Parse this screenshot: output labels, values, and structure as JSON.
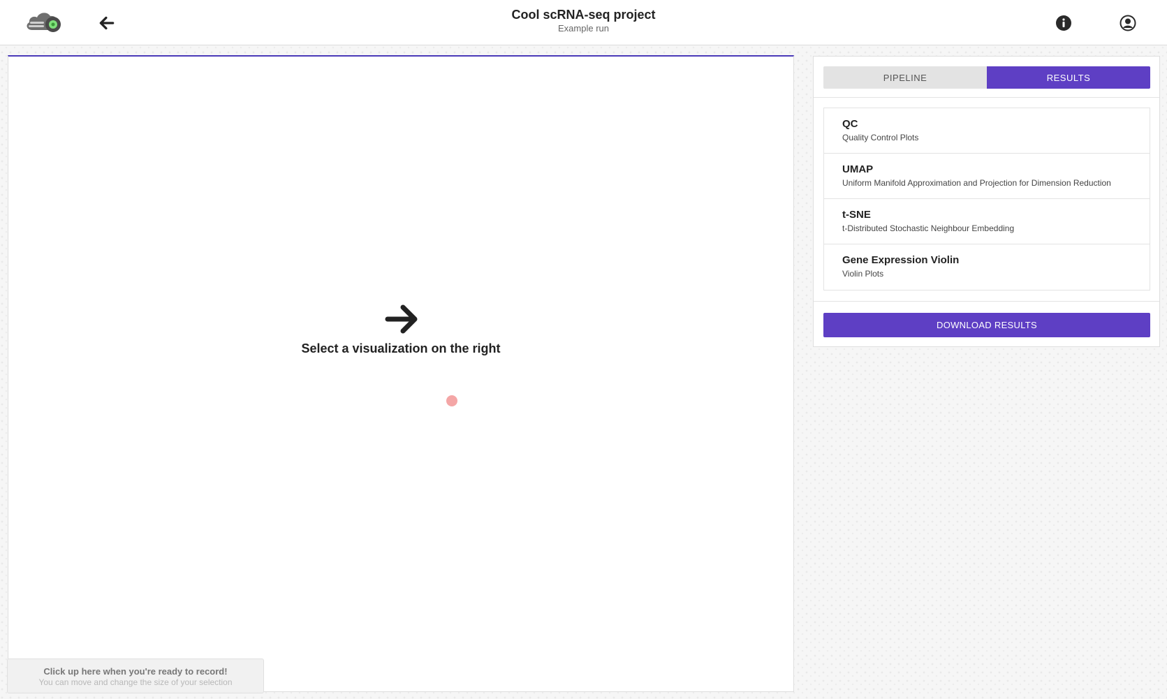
{
  "header": {
    "title": "Cool scRNA-seq project",
    "subtitle": "Example run"
  },
  "icons": {
    "logo": "cloud-gear-logo",
    "back": "arrow-left-icon",
    "info": "info-circle-icon",
    "user": "user-circle-icon",
    "placeholder": "arrow-right-icon"
  },
  "viz": {
    "placeholder_text": "Select a visualization on the right"
  },
  "sidebar": {
    "tabs": [
      {
        "label": "PIPELINE",
        "active": false
      },
      {
        "label": "RESULTS",
        "active": true
      }
    ],
    "results": [
      {
        "name": "QC",
        "description": "Quality Control Plots"
      },
      {
        "name": "UMAP",
        "description": "Uniform Manifold Approximation and Projection for Dimension Reduction"
      },
      {
        "name": "t-SNE",
        "description": "t-Distributed Stochastic Neighbour Embedding"
      },
      {
        "name": "Gene Expression Violin",
        "description": "Violin Plots"
      }
    ],
    "download_label": "DOWNLOAD RESULTS"
  },
  "recorder": {
    "title": "Click up here when you're ready to record!",
    "subtitle": "You can move and change the size of your selection"
  },
  "colors": {
    "accent": "#5e3fc4",
    "cursor_dot": "#f4a6a6"
  }
}
